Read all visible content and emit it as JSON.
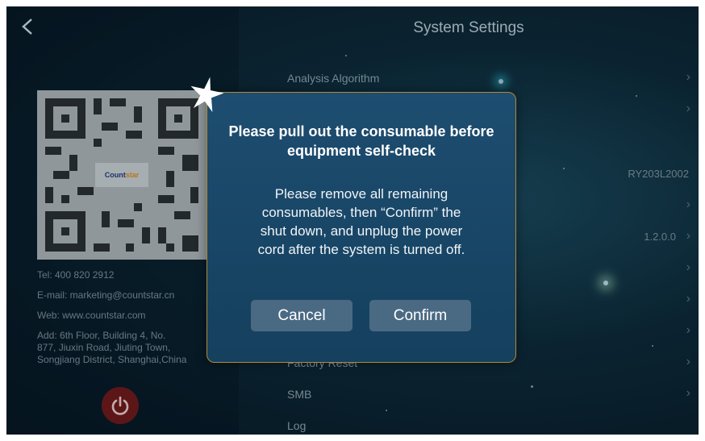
{
  "header": {
    "title": "System Settings"
  },
  "contact": {
    "tel": "Tel: 400 820 2912",
    "email": "E-mail: marketing@countstar.cn",
    "web": "Web: www.countstar.com",
    "address_line1": "Add: 6th Floor, Building 4, No.",
    "address_line2": "877, Jiuxin Road, Jiuting Town,",
    "address_line3": "Songjiang District, Shanghai,China"
  },
  "qr": {
    "logo_part1": "Count",
    "logo_part2": "star"
  },
  "menu": {
    "items": [
      {
        "label": "Analysis Algorithm",
        "value": "",
        "chevron": "›"
      },
      {
        "label": "",
        "value": "",
        "chevron": "›"
      },
      {
        "label": "",
        "value": "RY203L2002",
        "chevron": ""
      },
      {
        "label": "",
        "value": "",
        "chevron": "›"
      },
      {
        "label": "",
        "value": "1.2.0.0",
        "chevron": "›"
      },
      {
        "label": "",
        "value": "",
        "chevron": "›"
      },
      {
        "label": "",
        "value": "",
        "chevron": "›"
      },
      {
        "label": "",
        "value": "",
        "chevron": "›"
      },
      {
        "label": "Factory Reset",
        "value": "",
        "chevron": "›"
      },
      {
        "label": "SMB",
        "value": "",
        "chevron": "›"
      },
      {
        "label": "Log",
        "value": "",
        "chevron": ""
      }
    ]
  },
  "dialog": {
    "title": "Please pull out the consumable before equipment self-check",
    "body": "Please remove all remaining consumables, then “Confirm” the shut down, and unplug the power cord after the system is turned off.",
    "cancel_label": "Cancel",
    "confirm_label": "Confirm"
  },
  "colors": {
    "power": "#6e1a1d",
    "dialog_border": "#b08a3c",
    "button": "#4a6a84"
  },
  "icons": {
    "back": "chevron-left-icon",
    "power": "power-icon",
    "star": "star-icon"
  }
}
